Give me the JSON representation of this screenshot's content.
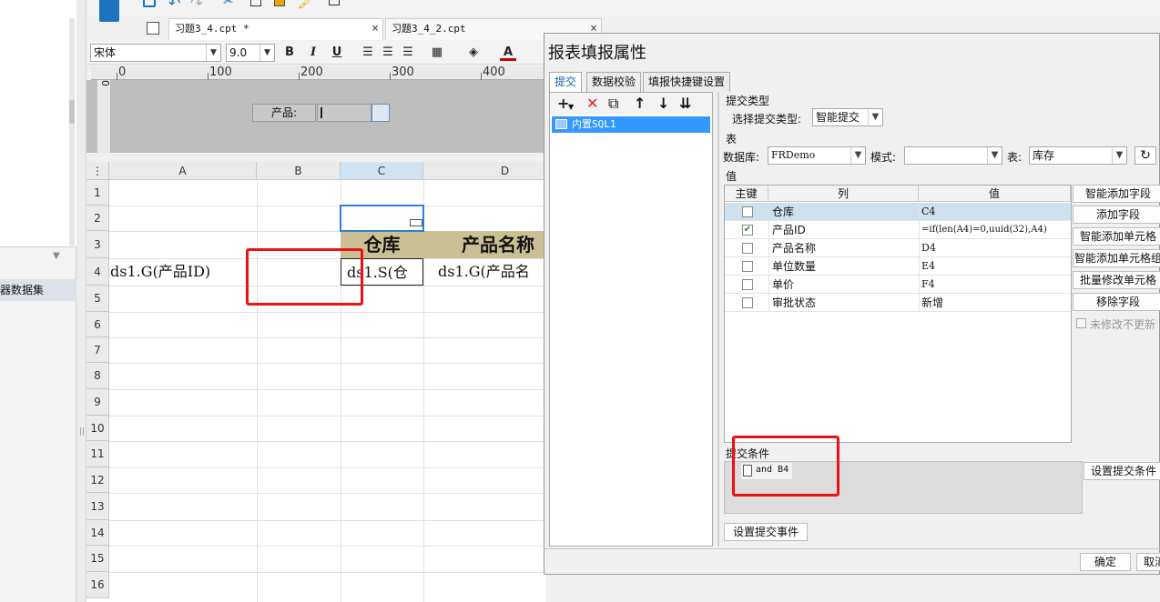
{
  "left_panel": {
    "dataset_item": "器数据集"
  },
  "file_tabs": [
    {
      "label": "习题3_4.cpt *",
      "close": "×"
    },
    {
      "label": "习题3_4_2.cpt",
      "close": "×"
    }
  ],
  "format_toolbar": {
    "font": "宋体",
    "size": "9.0",
    "bold": "B",
    "italic": "I",
    "underline": "U",
    "font_color": "A"
  },
  "ruler": [
    "0",
    "100",
    "200",
    "300",
    "400"
  ],
  "vruler": "0",
  "param": {
    "label": "产品:"
  },
  "grid": {
    "columns": [
      "A",
      "B",
      "C",
      "D"
    ],
    "rows": [
      "1",
      "2",
      "3",
      "4",
      "5",
      "6",
      "7",
      "8",
      "9",
      "10",
      "11",
      "12",
      "13",
      "14",
      "15",
      "16"
    ],
    "cells": {
      "c3": "仓库",
      "d3": "产品名称",
      "a4": "ds1.G(产品ID)",
      "c4": "ds1.S(仓",
      "d4": "ds1.G(产品名"
    }
  },
  "dialog": {
    "title": "报表填报属性",
    "tabs": [
      "提交",
      "数据校验",
      "填报快捷键设置"
    ],
    "list_item": "内置SQL1",
    "submit_type_section": "提交类型",
    "submit_type_label": "选择提交类型:",
    "submit_type_value": "智能提交",
    "table_section": "表",
    "db_label": "数据库:",
    "db_value": "FRDemo",
    "mode_label": "模式:",
    "mode_value": "",
    "table_label": "表:",
    "table_value": "库存",
    "value_section": "值",
    "table_headers": [
      "主键",
      "列",
      "值"
    ],
    "rows": [
      {
        "key": false,
        "col": "仓库",
        "val": "C4"
      },
      {
        "key": true,
        "col": "产品ID",
        "val": "=if(len(A4)=0,uuid(32),A4)"
      },
      {
        "key": false,
        "col": "产品名称",
        "val": "D4"
      },
      {
        "key": false,
        "col": "单位数量",
        "val": "E4"
      },
      {
        "key": false,
        "col": "单价",
        "val": "F4"
      },
      {
        "key": false,
        "col": "审批状态",
        "val": "新增"
      }
    ],
    "right_buttons": [
      "智能添加字段",
      "添加字段",
      "智能添加单元格",
      "智能添加单元格组",
      "批量修改单元格",
      "移除字段"
    ],
    "no_update_checkbox": "未修改不更新",
    "condition_section": "提交条件",
    "condition_item": "and B4",
    "set_condition_button": "设置提交条件",
    "set_event_button": "设置提交事件",
    "ok_button": "确定",
    "cancel_button": "取消"
  }
}
